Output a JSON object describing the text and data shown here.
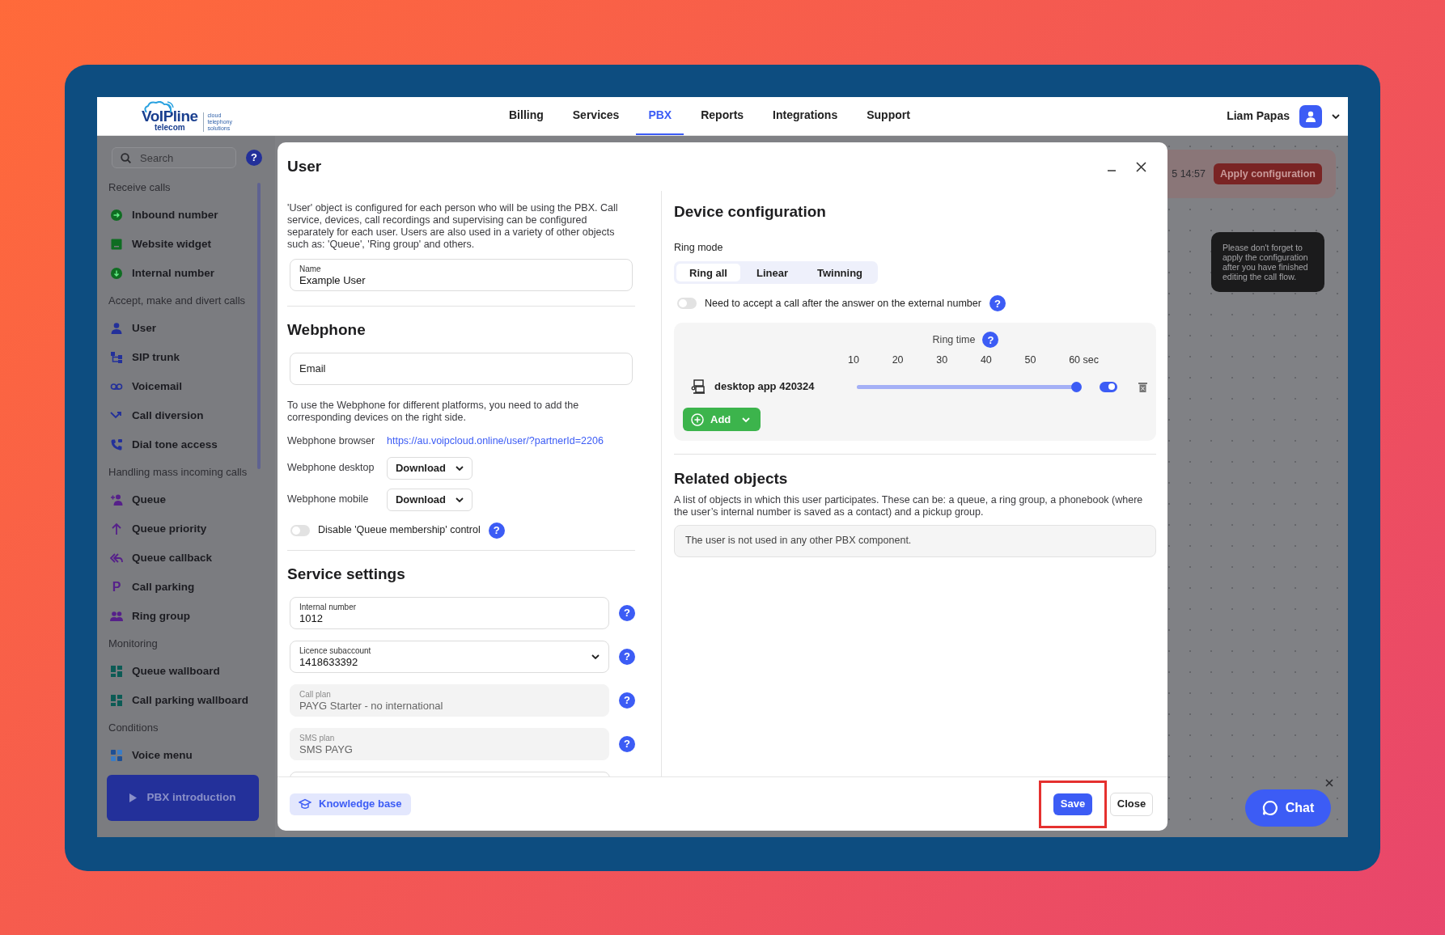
{
  "header": {
    "logo": {
      "wordmark": "VoIPline",
      "sub": "telecom",
      "tagline": "cloud telephony solutions"
    },
    "nav": [
      {
        "label": "Billing",
        "selected": false
      },
      {
        "label": "Services",
        "selected": false
      },
      {
        "label": "PBX",
        "selected": true
      },
      {
        "label": "Reports",
        "selected": false
      },
      {
        "label": "Integrations",
        "selected": false
      },
      {
        "label": "Support",
        "selected": false
      }
    ],
    "user_name": "Liam Papas"
  },
  "sidebar": {
    "search": {
      "placeholder": "Search"
    },
    "help": "?",
    "sections": [
      {
        "title": "Receive calls",
        "items": [
          {
            "label": "Inbound number",
            "kind": "inbound"
          },
          {
            "label": "Website widget",
            "kind": "widget"
          },
          {
            "label": "Internal number",
            "kind": "internal"
          }
        ]
      },
      {
        "title": "Accept, make and divert calls",
        "items": [
          {
            "label": "User",
            "kind": "user"
          },
          {
            "label": "SIP trunk",
            "kind": "trunk"
          },
          {
            "label": "Voicemail",
            "kind": "voicemail"
          },
          {
            "label": "Call diversion",
            "kind": "diversion"
          },
          {
            "label": "Dial tone access",
            "kind": "dialtone"
          }
        ]
      },
      {
        "title": "Handling mass incoming calls",
        "items": [
          {
            "label": "Queue",
            "kind": "queue"
          },
          {
            "label": "Queue priority",
            "kind": "priority"
          },
          {
            "label": "Queue callback",
            "kind": "callback"
          },
          {
            "label": "Call parking",
            "kind": "parking",
            "glyph": "P"
          },
          {
            "label": "Ring group",
            "kind": "ringgroup"
          }
        ]
      },
      {
        "title": "Monitoring",
        "items": [
          {
            "label": "Queue wallboard",
            "kind": "wallboard"
          },
          {
            "label": "Call parking wallboard",
            "kind": "wallboard"
          }
        ]
      },
      {
        "title": "Conditions",
        "items": [
          {
            "label": "Voice menu",
            "kind": "voicemenu"
          }
        ]
      }
    ],
    "intro_button": "PBX introduction"
  },
  "canvas": {
    "timestamp": "5 14:57",
    "apply_button": "Apply configuration",
    "tooltip": "Please don't forget to apply the configuration after you have finished editing the call flow."
  },
  "modal": {
    "title": "User",
    "description": "'User' object is configured for each person who will be using the PBX. Call service, devices, call recordings and supervising can be configured separately for each user. Users are also used in a variety of other objects such as: 'Queue', 'Ring group' and others.",
    "name_field": {
      "label": "Name",
      "value": "Example User"
    },
    "webphone": {
      "title": "Webphone",
      "email_placeholder": "Email",
      "hint": "To use the Webphone for different platforms, you need to add the corresponding devices on the right side.",
      "browser": {
        "label": "Webphone browser",
        "link": "https://au.voipcloud.online/user/?partnerId=2206"
      },
      "downloads": [
        {
          "label": "Webphone desktop",
          "button": "Download"
        },
        {
          "label": "Webphone mobile",
          "button": "Download"
        }
      ],
      "queue_toggle": {
        "label": "Disable 'Queue membership' control",
        "on": false,
        "help": "?"
      }
    },
    "service": {
      "title": "Service settings",
      "fields": [
        {
          "kind": "input",
          "label": "Internal number",
          "value": "1012",
          "help": "?"
        },
        {
          "kind": "select",
          "label": "Licence subaccount",
          "value": "1418633392",
          "help": "?"
        },
        {
          "kind": "readonly",
          "label": "Call plan",
          "value": "PAYG Starter - no international",
          "help": "?"
        },
        {
          "kind": "readonly",
          "label": "SMS plan",
          "value": "SMS PAYG",
          "help": "?"
        }
      ]
    },
    "device": {
      "title": "Device configuration",
      "ring_mode_label": "Ring mode",
      "ring_modes": [
        {
          "label": "Ring all",
          "selected": true
        },
        {
          "label": "Linear",
          "selected": false
        },
        {
          "label": "Twinning",
          "selected": false
        }
      ],
      "accept_toggle": {
        "label": "Need to accept a call after the answer on the external number",
        "on": false,
        "help": "?"
      },
      "ring_time": {
        "label": "Ring time",
        "help": "?",
        "ticks": [
          "10",
          "20",
          "30",
          "40",
          "50",
          "60 sec"
        ]
      },
      "devices": [
        {
          "name": "desktop app 420324",
          "level": 1,
          "on": true
        }
      ],
      "add_button": "Add"
    },
    "related": {
      "title": "Related objects",
      "description": "A list of objects in which this user participates. These can be: a queue, a ring group, a phonebook (where the user’s internal number is saved as a contact) and a pickup group.",
      "empty_text": "The user is not used in any other PBX component."
    },
    "footer": {
      "knowledge_base": "Knowledge base",
      "save": {
        "label": "Save",
        "highlighted": true
      },
      "close": "Close"
    }
  },
  "chat": {
    "label": "Chat"
  }
}
